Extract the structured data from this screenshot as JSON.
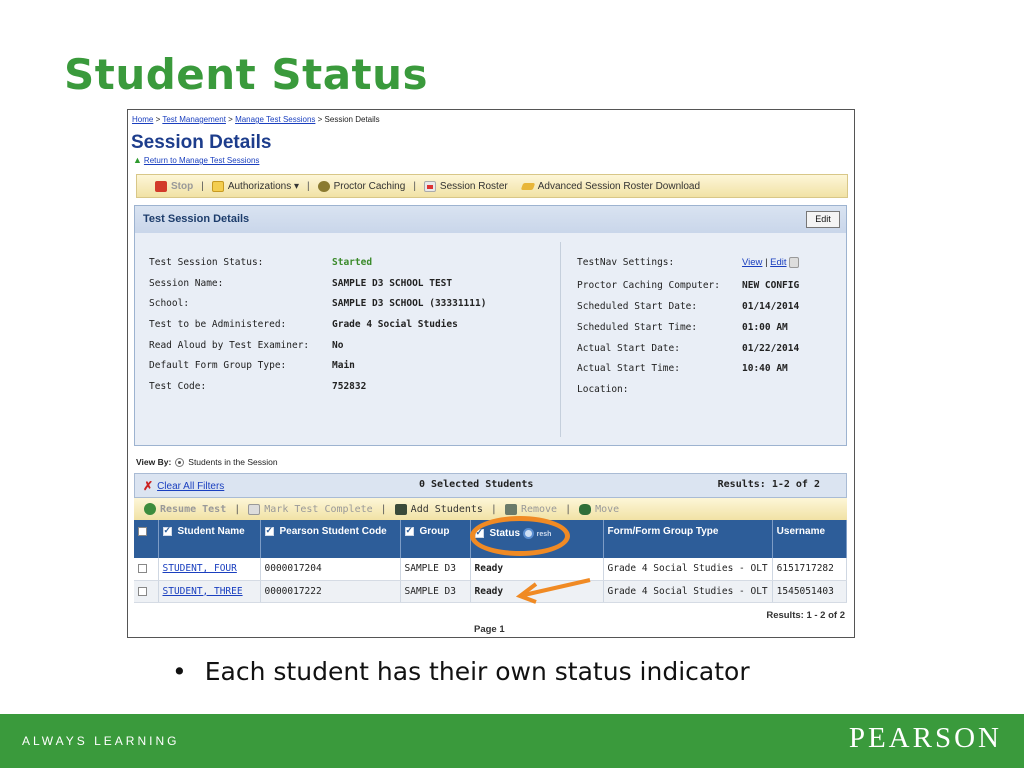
{
  "slide": {
    "title": "Student Status",
    "bullet_mark": "•",
    "bullet": "Each student has their own status indicator"
  },
  "breadcrumb": {
    "home": "Home",
    "sep": ">",
    "test_management": "Test Management",
    "manage_sessions": "Manage Test Sessions",
    "current": "Session Details"
  },
  "page": {
    "heading": "Session Details",
    "return_link": "Return to Manage Test Sessions"
  },
  "toolbar": {
    "stop": "Stop",
    "authorizations": "Authorizations ▾",
    "proctor_caching": "Proctor Caching",
    "session_roster": "Session Roster",
    "advanced_roster": "Advanced Session Roster Download",
    "sep": "|"
  },
  "details": {
    "title": "Test Session Details",
    "edit_label": "Edit",
    "left": [
      {
        "label": "Test Session Status:",
        "value": "Started"
      },
      {
        "label": "Session Name:",
        "value": "SAMPLE D3 SCHOOL TEST"
      },
      {
        "label": "School:",
        "value": "SAMPLE D3 SCHOOL (33331111)"
      },
      {
        "label": "Test to be Administered:",
        "value": "Grade 4 Social Studies"
      },
      {
        "label": "Read Aloud by Test Examiner:",
        "value": "No"
      },
      {
        "label": "Default Form Group Type:",
        "value": "Main"
      },
      {
        "label": "Test Code:",
        "value": "752832"
      }
    ],
    "right": [
      {
        "label": "TestNav Settings:",
        "value": ""
      },
      {
        "label": "Proctor Caching Computer:",
        "value": "NEW CONFIG"
      },
      {
        "label": "Scheduled Start Date:",
        "value": "01/14/2014"
      },
      {
        "label": "Scheduled Start Time:",
        "value": "01:00 AM"
      },
      {
        "label": "Actual Start Date:",
        "value": "01/22/2014"
      },
      {
        "label": "Actual Start Time:",
        "value": "10:40 AM"
      },
      {
        "label": "Location:",
        "value": ""
      }
    ],
    "testnav_view": "View",
    "testnav_sep": "|",
    "testnav_edit": "Edit"
  },
  "view_by": {
    "label": "View By:",
    "option": "Students in the Session"
  },
  "filters": {
    "clear": "Clear All Filters",
    "selected": "0 Selected Students",
    "results": "Results: 1-2 of 2"
  },
  "actions": {
    "resume": "Resume Test",
    "mark_complete": "Mark Test Complete",
    "add_students": "Add Students",
    "remove": "Remove",
    "move": "Move",
    "sep": "|"
  },
  "table": {
    "headers": {
      "student_name": "Student Name",
      "student_code": "Pearson Student Code",
      "group": "Group",
      "status": "Status",
      "refresh": "resh",
      "form": "Form/Form Group Type",
      "username": "Username"
    },
    "rows": [
      {
        "name": "STUDENT, FOUR",
        "code": "0000017204",
        "group": "SAMPLE D3",
        "status": "Ready",
        "form": "Grade 4 Social Studies - OLT",
        "username": "6151717282"
      },
      {
        "name": "STUDENT, THREE",
        "code": "0000017222",
        "group": "SAMPLE D3",
        "status": "Ready",
        "form": "Grade 4 Social Studies - OLT",
        "username": "1545051403"
      }
    ]
  },
  "footer_results": "Results:  1 - 2 of 2",
  "page_label": "Page 1",
  "footer": {
    "tagline": "ALWAYS LEARNING",
    "brand": "PEARSON"
  },
  "colors": {
    "title_green": "#3a9a3c",
    "header_blue": "#2d5d99",
    "highlight_orange": "#f08a24",
    "started_green": "#3a8a2a"
  }
}
